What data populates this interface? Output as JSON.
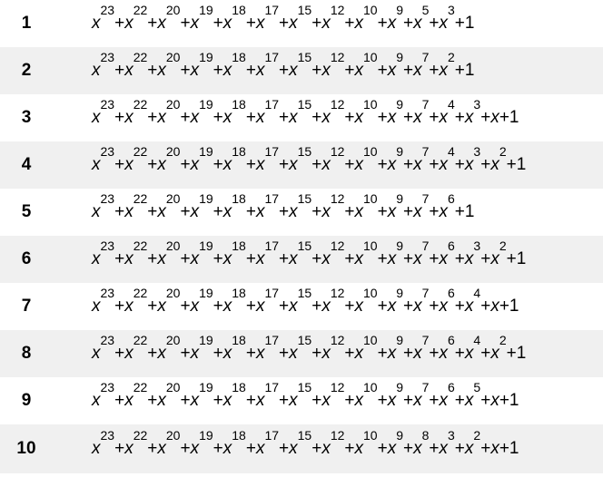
{
  "rows": [
    {
      "index": "1",
      "terms": [
        [
          "x",
          "23"
        ],
        [
          "x",
          "22"
        ],
        [
          "x",
          "20"
        ],
        [
          "x",
          "19"
        ],
        [
          "x",
          "18"
        ],
        [
          "x",
          "17"
        ],
        [
          "x",
          "15"
        ],
        [
          "x",
          "12"
        ],
        [
          "x",
          "10"
        ],
        [
          "x",
          "9"
        ],
        [
          "x",
          "5"
        ],
        [
          "x",
          "3"
        ],
        [
          "1",
          ""
        ]
      ]
    },
    {
      "index": "2",
      "terms": [
        [
          "x",
          "23"
        ],
        [
          "x",
          "22"
        ],
        [
          "x",
          "20"
        ],
        [
          "x",
          "19"
        ],
        [
          "x",
          "18"
        ],
        [
          "x",
          "17"
        ],
        [
          "x",
          "15"
        ],
        [
          "x",
          "12"
        ],
        [
          "x",
          "10"
        ],
        [
          "x",
          "9"
        ],
        [
          "x",
          "7"
        ],
        [
          "x",
          "2"
        ],
        [
          "1",
          ""
        ]
      ]
    },
    {
      "index": "3",
      "terms": [
        [
          "x",
          "23"
        ],
        [
          "x",
          "22"
        ],
        [
          "x",
          "20"
        ],
        [
          "x",
          "19"
        ],
        [
          "x",
          "18"
        ],
        [
          "x",
          "17"
        ],
        [
          "x",
          "15"
        ],
        [
          "x",
          "12"
        ],
        [
          "x",
          "10"
        ],
        [
          "x",
          "9"
        ],
        [
          "x",
          "7"
        ],
        [
          "x",
          "4"
        ],
        [
          "x",
          "3"
        ],
        [
          "x",
          ""
        ],
        [
          "1",
          ""
        ]
      ]
    },
    {
      "index": "4",
      "terms": [
        [
          "x",
          "23"
        ],
        [
          "x",
          "22"
        ],
        [
          "x",
          "20"
        ],
        [
          "x",
          "19"
        ],
        [
          "x",
          "18"
        ],
        [
          "x",
          "17"
        ],
        [
          "x",
          "15"
        ],
        [
          "x",
          "12"
        ],
        [
          "x",
          "10"
        ],
        [
          "x",
          "9"
        ],
        [
          "x",
          "7"
        ],
        [
          "x",
          "4"
        ],
        [
          "x",
          "3"
        ],
        [
          "x",
          "2"
        ],
        [
          "1",
          ""
        ]
      ]
    },
    {
      "index": "5",
      "terms": [
        [
          "x",
          "23"
        ],
        [
          "x",
          "22"
        ],
        [
          "x",
          "20"
        ],
        [
          "x",
          "19"
        ],
        [
          "x",
          "18"
        ],
        [
          "x",
          "17"
        ],
        [
          "x",
          "15"
        ],
        [
          "x",
          "12"
        ],
        [
          "x",
          "10"
        ],
        [
          "x",
          "9"
        ],
        [
          "x",
          "7"
        ],
        [
          "x",
          "6"
        ],
        [
          "1",
          ""
        ]
      ]
    },
    {
      "index": "6",
      "terms": [
        [
          "x",
          "23"
        ],
        [
          "x",
          "22"
        ],
        [
          "x",
          "20"
        ],
        [
          "x",
          "19"
        ],
        [
          "x",
          "18"
        ],
        [
          "x",
          "17"
        ],
        [
          "x",
          "15"
        ],
        [
          "x",
          "12"
        ],
        [
          "x",
          "10"
        ],
        [
          "x",
          "9"
        ],
        [
          "x",
          "7"
        ],
        [
          "x",
          "6"
        ],
        [
          "x",
          "3"
        ],
        [
          "x",
          "2"
        ],
        [
          "1",
          ""
        ]
      ]
    },
    {
      "index": "7",
      "terms": [
        [
          "x",
          "23"
        ],
        [
          "x",
          "22"
        ],
        [
          "x",
          "20"
        ],
        [
          "x",
          "19"
        ],
        [
          "x",
          "18"
        ],
        [
          "x",
          "17"
        ],
        [
          "x",
          "15"
        ],
        [
          "x",
          "12"
        ],
        [
          "x",
          "10"
        ],
        [
          "x",
          "9"
        ],
        [
          "x",
          "7"
        ],
        [
          "x",
          "6"
        ],
        [
          "x",
          "4"
        ],
        [
          "x",
          ""
        ],
        [
          "1",
          ""
        ]
      ]
    },
    {
      "index": "8",
      "terms": [
        [
          "x",
          "23"
        ],
        [
          "x",
          "22"
        ],
        [
          "x",
          "20"
        ],
        [
          "x",
          "19"
        ],
        [
          "x",
          "18"
        ],
        [
          "x",
          "17"
        ],
        [
          "x",
          "15"
        ],
        [
          "x",
          "12"
        ],
        [
          "x",
          "10"
        ],
        [
          "x",
          "9"
        ],
        [
          "x",
          "7"
        ],
        [
          "x",
          "6"
        ],
        [
          "x",
          "4"
        ],
        [
          "x",
          "2"
        ],
        [
          "1",
          ""
        ]
      ]
    },
    {
      "index": "9",
      "terms": [
        [
          "x",
          "23"
        ],
        [
          "x",
          "22"
        ],
        [
          "x",
          "20"
        ],
        [
          "x",
          "19"
        ],
        [
          "x",
          "18"
        ],
        [
          "x",
          "17"
        ],
        [
          "x",
          "15"
        ],
        [
          "x",
          "12"
        ],
        [
          "x",
          "10"
        ],
        [
          "x",
          "9"
        ],
        [
          "x",
          "7"
        ],
        [
          "x",
          "6"
        ],
        [
          "x",
          "5"
        ],
        [
          "x",
          ""
        ],
        [
          "1",
          ""
        ]
      ]
    },
    {
      "index": "10",
      "terms": [
        [
          "x",
          "23"
        ],
        [
          "x",
          "22"
        ],
        [
          "x",
          "20"
        ],
        [
          "x",
          "19"
        ],
        [
          "x",
          "18"
        ],
        [
          "x",
          "17"
        ],
        [
          "x",
          "15"
        ],
        [
          "x",
          "12"
        ],
        [
          "x",
          "10"
        ],
        [
          "x",
          "9"
        ],
        [
          "x",
          "8"
        ],
        [
          "x",
          "3"
        ],
        [
          "x",
          "2"
        ],
        [
          "x",
          ""
        ],
        [
          "1",
          ""
        ]
      ]
    }
  ]
}
